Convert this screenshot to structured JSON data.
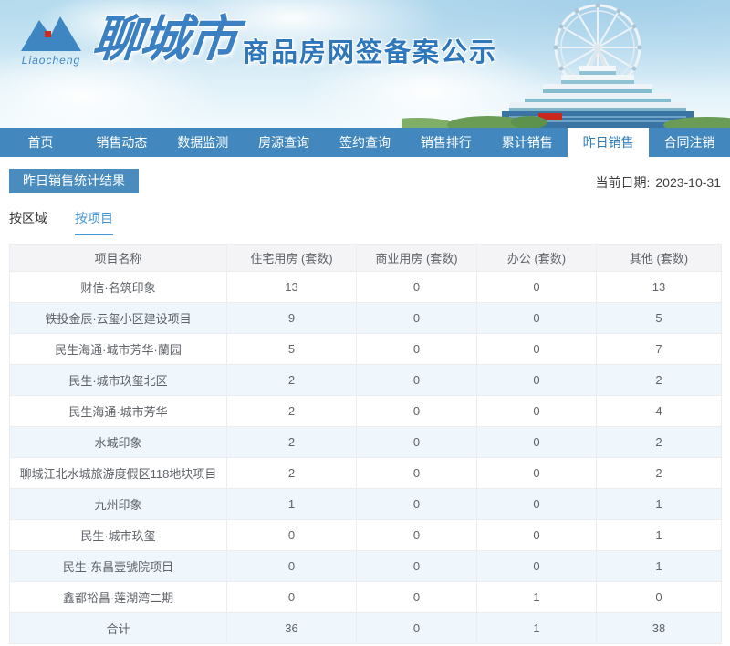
{
  "banner": {
    "city": "聊城市",
    "title": "商品房网签备案公示",
    "logo_text": "Liaocheng"
  },
  "nav": {
    "items": [
      {
        "id": "home",
        "label": "首页",
        "active": false
      },
      {
        "id": "sales-dynamics",
        "label": "销售动态",
        "active": false
      },
      {
        "id": "data-monitoring",
        "label": "数据监测",
        "active": false
      },
      {
        "id": "listing-search",
        "label": "房源查询",
        "active": false
      },
      {
        "id": "contract-search",
        "label": "签约查询",
        "active": false
      },
      {
        "id": "sales-ranking",
        "label": "销售排行",
        "active": false
      },
      {
        "id": "cumulative-sales",
        "label": "累计销售",
        "active": false
      },
      {
        "id": "yesterday-sales",
        "label": "昨日销售",
        "active": true
      },
      {
        "id": "contract-cancellation",
        "label": "合同注销",
        "active": false
      }
    ]
  },
  "page": {
    "section_title": "昨日销售统计结果",
    "date_label": "当前日期:",
    "date_value": "2023-10-31",
    "tabs": [
      {
        "id": "by-region",
        "label": "按区域",
        "active": false
      },
      {
        "id": "by-project",
        "label": "按项目",
        "active": true
      }
    ]
  },
  "table": {
    "headers": [
      "项目名称",
      "住宅用房 (套数)",
      "商业用房 (套数)",
      "办公 (套数)",
      "其他 (套数)"
    ],
    "rows": [
      [
        "财信·名筑印象",
        "13",
        "0",
        "0",
        "13"
      ],
      [
        "铁投金辰·云玺小区建设项目",
        "9",
        "0",
        "0",
        "5"
      ],
      [
        "民生海通·城市芳华·蘭园",
        "5",
        "0",
        "0",
        "7"
      ],
      [
        "民生·城市玖玺北区",
        "2",
        "0",
        "0",
        "2"
      ],
      [
        "民生海通·城市芳华",
        "2",
        "0",
        "0",
        "4"
      ],
      [
        "水城印象",
        "2",
        "0",
        "0",
        "2"
      ],
      [
        "聊城江北水城旅游度假区118地块项目",
        "2",
        "0",
        "0",
        "2"
      ],
      [
        "九州印象",
        "1",
        "0",
        "0",
        "1"
      ],
      [
        "民生·城市玖玺",
        "0",
        "0",
        "0",
        "1"
      ],
      [
        "民生·东昌壹號院项目",
        "0",
        "0",
        "0",
        "1"
      ],
      [
        "鑫都裕昌·莲湖湾二期",
        "0",
        "0",
        "1",
        "0"
      ],
      [
        "合计",
        "36",
        "0",
        "1",
        "38"
      ]
    ]
  },
  "colors": {
    "nav_blue": "#4288be",
    "badge_blue": "#4a8cbe",
    "active_tab_blue": "#4596d2",
    "stripe_blue": "#eff7fd",
    "header_gray": "#f4f4f6",
    "brand_blue": "#2e77bb"
  }
}
